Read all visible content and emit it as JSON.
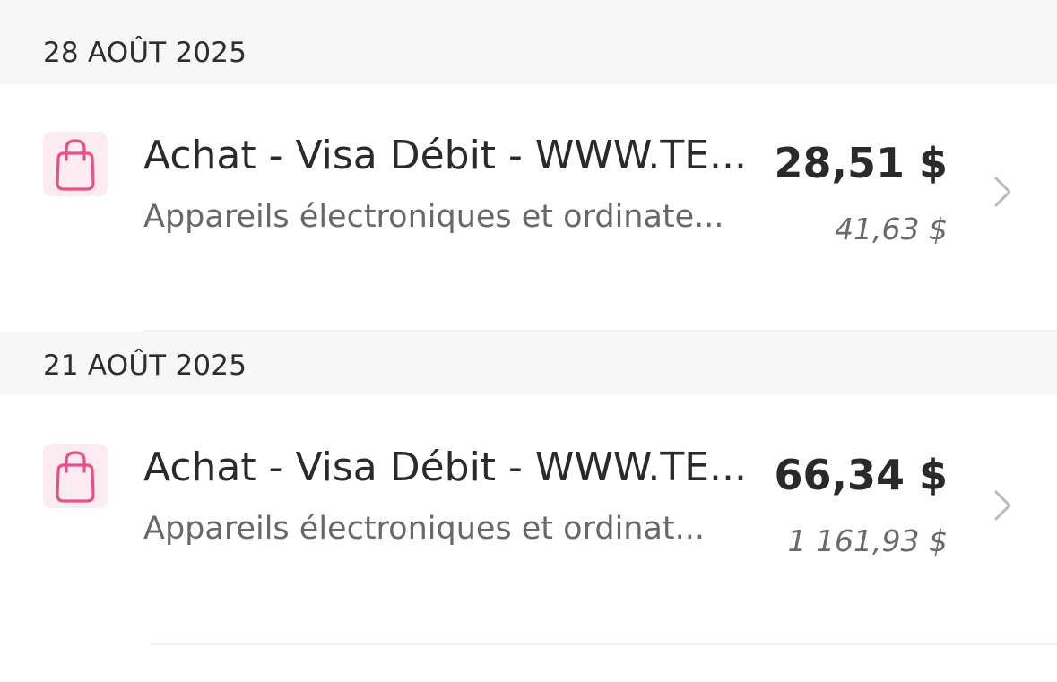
{
  "groups": [
    {
      "date": "28 AOÛT 2025",
      "transactions": [
        {
          "title": "Achat - Visa Débit - WWW.TE...",
          "category": "Appareils électroniques et ordinate...",
          "amount": "28,51 $",
          "balance": "41,63 $",
          "icon": "shopping-bag-icon"
        }
      ]
    },
    {
      "date": "21 AOÛT 2025",
      "transactions": [
        {
          "title": "Achat - Visa Débit - WWW.TE...",
          "category": "Appareils électroniques et ordinat...",
          "amount": "66,34 $",
          "balance": "1 161,93 $",
          "icon": "shopping-bag-icon"
        }
      ]
    }
  ],
  "colors": {
    "icon_accent": "#e8508a",
    "icon_background": "#fcebf1",
    "header_background": "#f7f7f8"
  }
}
